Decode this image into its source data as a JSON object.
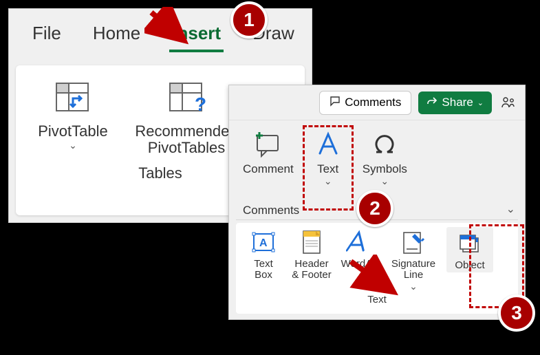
{
  "tabs": {
    "file": "File",
    "home": "Home",
    "insert": "Insert",
    "draw": "Draw"
  },
  "panel1": {
    "pivottable": "PivotTable",
    "recommended": "Recommended\nPivotTables",
    "group": "Tables"
  },
  "panel2_header": {
    "comments": "Comments",
    "share": "Share"
  },
  "panel2_row1": {
    "comment": "Comment",
    "text": "Text",
    "symbols": "Symbols",
    "group": "Comments"
  },
  "panel2_row2": {
    "textbox": "Text\nBox",
    "header_footer": "Header\n& Footer",
    "wordart": "WordArt",
    "signature": "Signature\nLine",
    "object": "Object",
    "group": "Text"
  },
  "badges": {
    "one": "1",
    "two": "2",
    "three": "3"
  }
}
